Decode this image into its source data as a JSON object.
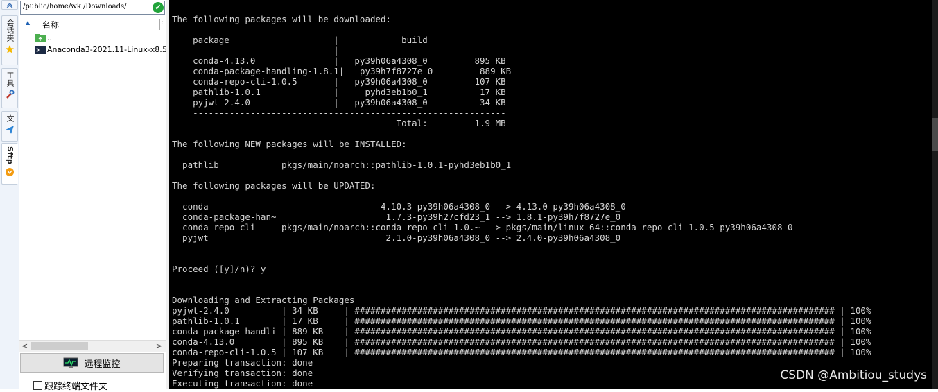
{
  "sidebar_tabs": [
    {
      "label": "会话夹"
    },
    {
      "label": "工具"
    },
    {
      "label": "文"
    },
    {
      "label": "Sftp"
    }
  ],
  "file_panel": {
    "path": "/public/home/wkl/Downloads/",
    "column_name": "名称",
    "files": [
      {
        "name": "..",
        "size": ""
      },
      {
        "name": "Anaconda3-2021.11-Linux-x8...",
        "size": "5"
      }
    ],
    "monitor_label": "远程监控",
    "follow_label": "跟踪终端文件夹"
  },
  "terminal": {
    "lines": [
      "The following packages will be downloaded:",
      "",
      "    package                    |            build",
      "    ---------------------------|-----------------",
      "    conda-4.13.0               |   py39h06a4308_0         895 KB",
      "    conda-package-handling-1.8.1|   py39h7f8727e_0         889 KB",
      "    conda-repo-cli-1.0.5       |   py39h06a4308_0         107 KB",
      "    pathlib-1.0.1              |     pyhd3eb1b0_1          17 KB",
      "    pyjwt-2.4.0                |   py39h06a4308_0          34 KB",
      "    ------------------------------------------------------------",
      "                                           Total:         1.9 MB",
      "",
      "The following NEW packages will be INSTALLED:",
      "",
      "  pathlib            pkgs/main/noarch::pathlib-1.0.1-pyhd3eb1b0_1",
      "",
      "The following packages will be UPDATED:",
      "",
      "  conda                                 4.10.3-py39h06a4308_0 --> 4.13.0-py39h06a4308_0",
      "  conda-package-han~                     1.7.3-py39h27cfd23_1 --> 1.8.1-py39h7f8727e_0",
      "  conda-repo-cli     pkgs/main/noarch::conda-repo-cli-1.0.~ --> pkgs/main/linux-64::conda-repo-cli-1.0.5-py39h06a4308_0",
      "  pyjwt                                  2.1.0-py39h06a4308_0 --> 2.4.0-py39h06a4308_0",
      "",
      "",
      "Proceed ([y]/n)? y",
      "",
      "",
      "Downloading and Extracting Packages",
      "pyjwt-2.4.0          | 34 KB     | ############################################################################################ | 100%",
      "pathlib-1.0.1        | 17 KB     | ############################################################################################ | 100%",
      "conda-package-handli | 889 KB    | ############################################################################################ | 100%",
      "conda-4.13.0         | 895 KB    | ############################################################################################ | 100%",
      "conda-repo-cli-1.0.5 | 107 KB    | ############################################################################################ | 100%",
      "Preparing transaction: done",
      "Verifying transaction: done",
      "Executing transaction: done"
    ]
  },
  "watermark": "CSDN @Ambitiou_studys",
  "colors": {
    "terminal_bg": "#000000",
    "terminal_fg": "#d4d4d4",
    "path_ok": "#21a33a"
  }
}
